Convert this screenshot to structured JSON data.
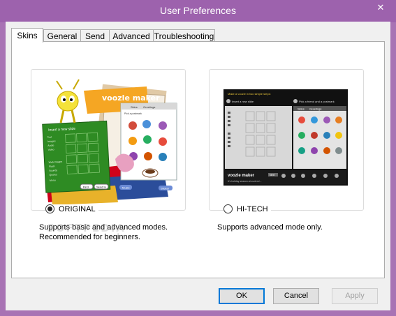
{
  "window": {
    "title": "User Preferences",
    "close_glyph": "✕"
  },
  "tabs": [
    {
      "label": "Skins",
      "active": true
    },
    {
      "label": "General",
      "active": false
    },
    {
      "label": "Send",
      "active": false
    },
    {
      "label": "Advanced",
      "active": false
    },
    {
      "label": "Troubleshooting",
      "active": false
    }
  ],
  "skins": [
    {
      "label": "ORIGINAL",
      "selected": true,
      "description": [
        "Supports basic and advanced modes.",
        "Recommended for beginners."
      ],
      "preview": {
        "brand": "voozle maker",
        "panel_heading": "Insert a new slide",
        "tab_a": "Skins",
        "tab_b": "Greetings",
        "pick_label": "Pick a postmark",
        "buttons": [
          "Find",
          "Send to",
          "Music",
          "Sticker"
        ],
        "menu_items": [
          "Text",
          "Images",
          "Audio",
          "Video",
          "Web Images",
          "Flash",
          "Sounds",
          "Quotes",
          "Menu"
        ]
      }
    },
    {
      "label": "HI-TECH",
      "selected": false,
      "description": [
        "Supports advanced mode only."
      ],
      "preview": {
        "brand": "voozle maker",
        "header": "Make a voozle in two simple steps:",
        "step1": "Insert a new slide",
        "step2": "Pick a friend and a postmark",
        "tab_a": "Skins",
        "tab_b": "Greetings",
        "footer": "It's holiday season at voziem!...",
        "footer_btn": "Next"
      }
    }
  ],
  "buttons": {
    "ok": "OK",
    "cancel": "Cancel",
    "apply": "Apply"
  },
  "watermark": "SOFTPEDIA"
}
